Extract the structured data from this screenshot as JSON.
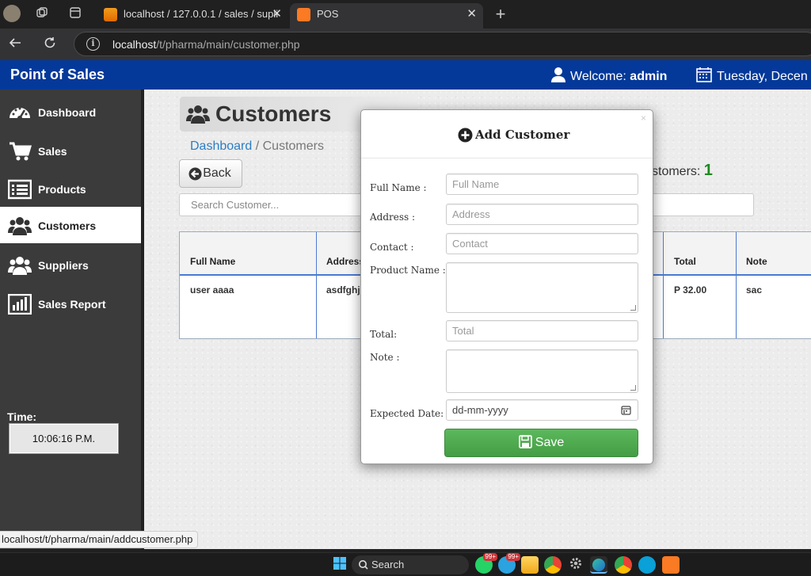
{
  "browser": {
    "tabs": [
      {
        "title": "localhost / 127.0.0.1 / sales / supli",
        "active": false
      },
      {
        "title": "POS",
        "active": true
      }
    ],
    "close_glyph": "✕",
    "new_tab_glyph": "+",
    "url_host": "localhost",
    "url_path": "/t/pharma/main/customer.php",
    "status_url": "localhost/t/pharma/main/addcustomer.php"
  },
  "header": {
    "brand": "Point of Sales",
    "welcome_prefix": "Welcome:",
    "user": "admin",
    "date": "Tuesday, Decen"
  },
  "sidebar": {
    "items": [
      {
        "label": "Dashboard",
        "icon": "dashboard-icon"
      },
      {
        "label": "Sales",
        "icon": "cart-icon"
      },
      {
        "label": "Products",
        "icon": "list-icon"
      },
      {
        "label": "Customers",
        "icon": "users-icon",
        "active": true
      },
      {
        "label": "Suppliers",
        "icon": "users-icon"
      },
      {
        "label": "Sales Report",
        "icon": "bar-chart-icon"
      }
    ],
    "time_label": "Time:",
    "time_value": "10:06:16 P.M."
  },
  "main": {
    "page_title": "Customers",
    "breadcrumb_link": "Dashboard",
    "breadcrumb_sep": " / ",
    "breadcrumb_current": "Customers",
    "back_label": "Back",
    "count_label": "stomers:",
    "count_value": "1",
    "search_placeholder": "Search Customer...",
    "table": {
      "headers": [
        "Full Name",
        "Address",
        "Total",
        "Note"
      ],
      "rows": [
        {
          "full_name": "user aaaa",
          "address": "asdfghjl",
          "total": "P 32.00",
          "note": "sac"
        }
      ]
    }
  },
  "modal": {
    "title": "Add Customer",
    "close": "×",
    "fields": [
      {
        "label": "Full Name :",
        "placeholder": "Full Name"
      },
      {
        "label": "Address :",
        "placeholder": "Address"
      },
      {
        "label": "Contact :",
        "placeholder": "Contact"
      },
      {
        "label": "Product Name :",
        "placeholder": ""
      },
      {
        "label": "Total:",
        "placeholder": "Total"
      },
      {
        "label": "Note :",
        "placeholder": ""
      },
      {
        "label": "Expected Date:",
        "placeholder": "dd-mm-yyyy"
      }
    ],
    "save_label": "Save"
  },
  "taskbar": {
    "search_label": "Search",
    "badge_whatsapp": "99+",
    "badge_telegram": "99+"
  },
  "colors": {
    "header_blue": "#04399a",
    "save_green": "#5cb85c",
    "link_blue": "#2b7ec4",
    "count_green": "#1e8a1e"
  }
}
